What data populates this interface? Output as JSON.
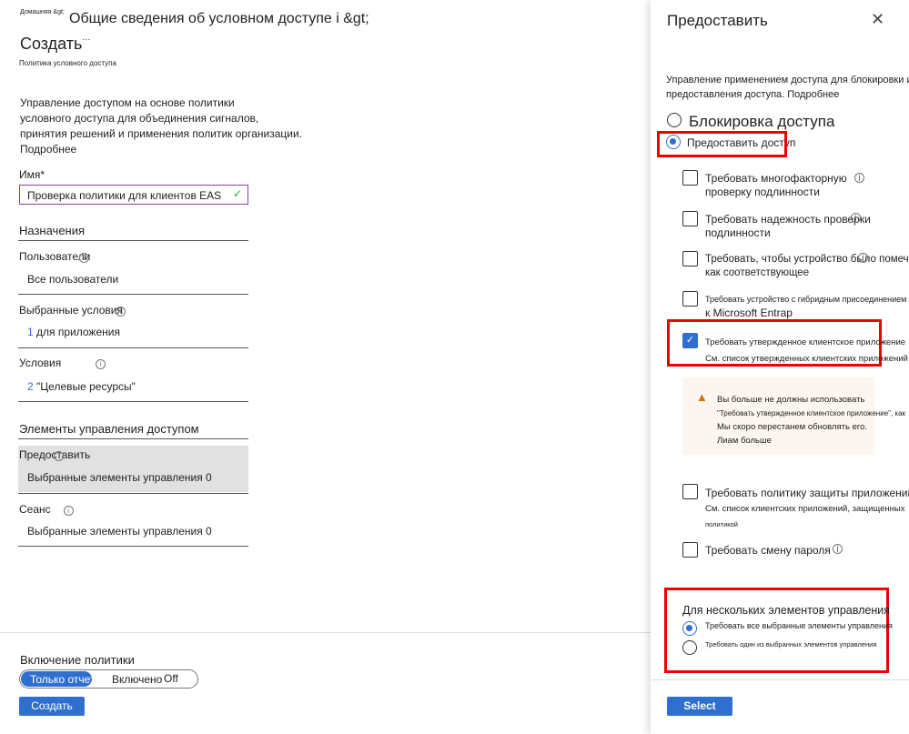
{
  "breadcrumb": {
    "home": "Домашняя &gt;",
    "current": "Общие сведения об условном доступе i &gt;"
  },
  "page": {
    "title": "Создать",
    "ellipsis": "···",
    "subtitle": "Политика условного доступа",
    "description": [
      "Управление доступом на основе политики",
      "условного доступа для объединения сигналов,",
      "принятия решений и применения политик организации."
    ],
    "learn_more": "Подробнее"
  },
  "form": {
    "name_label": "Имя",
    "required": "*",
    "name_value": "Проверка политики для клиентов EAS",
    "assignments": "Назначения",
    "users_label": "Пользователи",
    "users_value": "Все пользователи",
    "selected_conditions_label": "Выбранные условия",
    "selected_conditions_count": "1",
    "selected_conditions_value": "для приложения",
    "conditions_label": "Условия",
    "conditions_count": "2",
    "conditions_value": "\"Целевые ресурсы\"",
    "access_controls": "Элементы управления доступом",
    "grant_label": "Предоставить",
    "grant_value": "Выбранные элементы управления 0",
    "session_label": "Сеанс",
    "session_value": "Выбранные элементы управления 0"
  },
  "footer": {
    "enable_label": "Включение политики",
    "toggle": [
      "Только отчет",
      "Включено",
      "Off"
    ],
    "selected_toggle": "Только отчет",
    "create_button": "Создать"
  },
  "panel": {
    "title": "Предоставить",
    "description": [
      "Управление применением доступа для блокировки или",
      "предоставления доступа. Подробнее"
    ],
    "block": "Блокировка доступа",
    "grant": "Предоставить доступ",
    "selected": "grant",
    "options": [
      {
        "lines": [
          "Требовать многофакторную",
          "проверку подлинности"
        ],
        "checked": false
      },
      {
        "lines": [
          "Требовать надежность проверки",
          "подлинности"
        ],
        "checked": false
      },
      {
        "lines": [
          "Требовать, чтобы устройство было помечено",
          "как соответствующее"
        ],
        "checked": false
      },
      {
        "lines": [
          "Требовать устройство с гибридным присоединением",
          "к Microsoft Entrap"
        ],
        "checked": false
      },
      {
        "lines": [
          "Требовать утвержденное клиентское приложение",
          "См. список утвержденных клиентских приложений"
        ],
        "checked": true
      },
      {
        "lines": [
          "Требовать политику защиты приложений",
          "См. список клиентских приложений, защищенных",
          "политикой"
        ],
        "checked": false
      },
      {
        "lines": [
          "Требовать смену пароля"
        ],
        "checked": false
      }
    ],
    "warning": [
      "Вы больше не должны использовать",
      "\"Требовать утвержденное клиентское приложение\", как",
      "Мы скоро перестанем обновлять его.",
      "Лиам больше"
    ],
    "multi_label": "Для нескольких элементов управления",
    "multi_options": [
      "Требовать все выбранные элементы управления",
      "Требовать один из выбранных элементов управления"
    ],
    "multi_selected": 0,
    "select_button": "Select"
  },
  "colors": {
    "accent": "#2f6fd0",
    "highlight": "#e00000",
    "warning_bg": "#fdf6f0",
    "warning_icon": "#d9730d",
    "grant_bg": "#e1e1e1"
  }
}
